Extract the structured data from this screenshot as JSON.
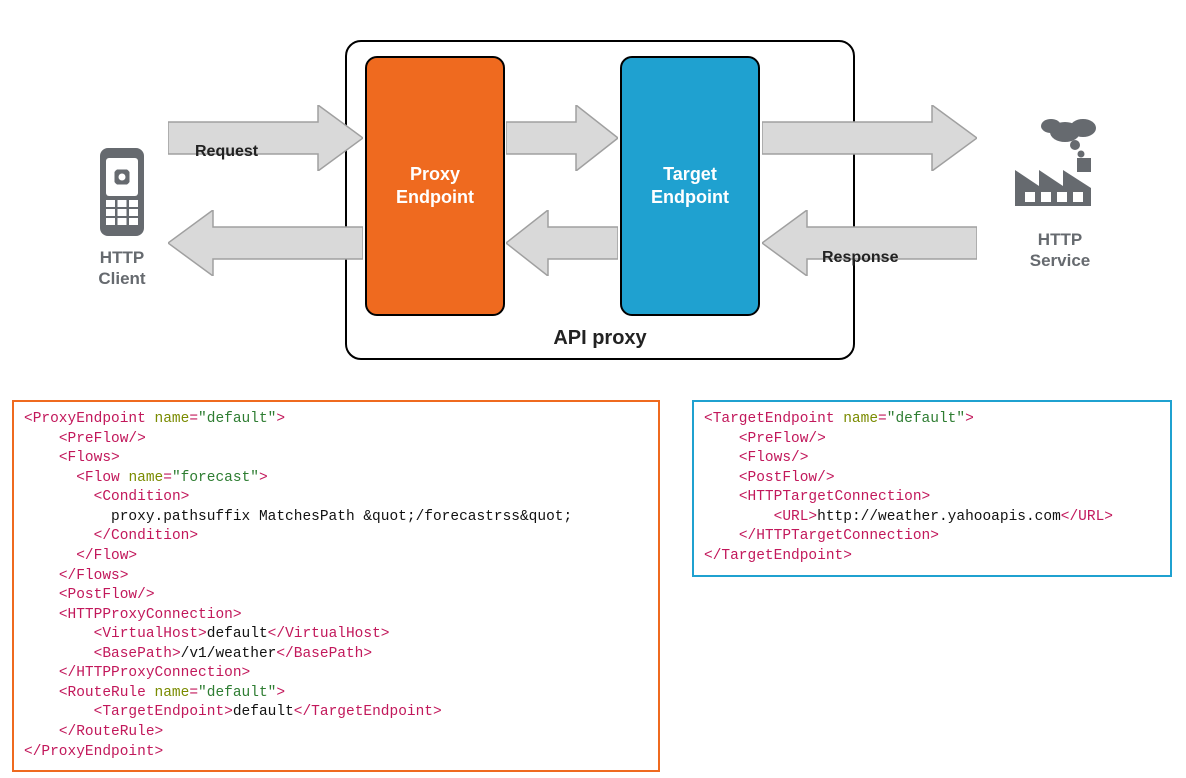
{
  "diagram": {
    "client_label": "HTTP\nClient",
    "service_label": "HTTP\nService",
    "request_label": "Request",
    "response_label": "Response",
    "proxy_container_title": "API proxy",
    "proxy_endpoint_label": "Proxy\nEndpoint",
    "target_endpoint_label": "Target\nEndpoint",
    "colors": {
      "proxy_endpoint": "#ef6a1f",
      "target_endpoint": "#1fa1d0",
      "arrow_fill": "#d9d9d9",
      "arrow_stroke": "#a0a0a0",
      "icon": "#666a6f"
    }
  },
  "code_proxy_endpoint": {
    "tokens": [
      [
        "tag",
        "<ProxyEndpoint "
      ],
      [
        "attr",
        "name"
      ],
      [
        "tag",
        "="
      ],
      [
        "val",
        "\"default\""
      ],
      [
        "tag",
        ">"
      ],
      [
        "nl",
        ""
      ],
      [
        "ind",
        "    "
      ],
      [
        "tag",
        "<PreFlow/>"
      ],
      [
        "nl",
        ""
      ],
      [
        "ind",
        "    "
      ],
      [
        "tag",
        "<Flows>"
      ],
      [
        "nl",
        ""
      ],
      [
        "ind",
        "      "
      ],
      [
        "tag",
        "<Flow "
      ],
      [
        "attr",
        "name"
      ],
      [
        "tag",
        "="
      ],
      [
        "val",
        "\"forecast\""
      ],
      [
        "tag",
        ">"
      ],
      [
        "nl",
        ""
      ],
      [
        "ind",
        "        "
      ],
      [
        "tag",
        "<Condition>"
      ],
      [
        "nl",
        ""
      ],
      [
        "ind",
        "          "
      ],
      [
        "txt",
        "proxy.pathsuffix MatchesPath &quot;/forecastrss&quot;"
      ],
      [
        "nl",
        ""
      ],
      [
        "ind",
        "        "
      ],
      [
        "tag",
        "</Condition>"
      ],
      [
        "nl",
        ""
      ],
      [
        "ind",
        "      "
      ],
      [
        "tag",
        "</Flow>"
      ],
      [
        "nl",
        ""
      ],
      [
        "ind",
        "    "
      ],
      [
        "tag",
        "</Flows>"
      ],
      [
        "nl",
        ""
      ],
      [
        "ind",
        "    "
      ],
      [
        "tag",
        "<PostFlow/>"
      ],
      [
        "nl",
        ""
      ],
      [
        "ind",
        "    "
      ],
      [
        "tag",
        "<HTTPProxyConnection>"
      ],
      [
        "nl",
        ""
      ],
      [
        "ind",
        "        "
      ],
      [
        "tag",
        "<VirtualHost>"
      ],
      [
        "txt",
        "default"
      ],
      [
        "tag",
        "</VirtualHost>"
      ],
      [
        "nl",
        ""
      ],
      [
        "ind",
        "        "
      ],
      [
        "tag",
        "<BasePath>"
      ],
      [
        "txt",
        "/v1/weather"
      ],
      [
        "tag",
        "</BasePath>"
      ],
      [
        "nl",
        ""
      ],
      [
        "ind",
        "    "
      ],
      [
        "tag",
        "</HTTPProxyConnection>"
      ],
      [
        "nl",
        ""
      ],
      [
        "ind",
        "    "
      ],
      [
        "tag",
        "<RouteRule "
      ],
      [
        "attr",
        "name"
      ],
      [
        "tag",
        "="
      ],
      [
        "val",
        "\"default\""
      ],
      [
        "tag",
        ">"
      ],
      [
        "nl",
        ""
      ],
      [
        "ind",
        "        "
      ],
      [
        "tag",
        "<TargetEndpoint>"
      ],
      [
        "txt",
        "default"
      ],
      [
        "tag",
        "</TargetEndpoint>"
      ],
      [
        "nl",
        ""
      ],
      [
        "ind",
        "    "
      ],
      [
        "tag",
        "</RouteRule>"
      ],
      [
        "nl",
        ""
      ],
      [
        "tag",
        "</ProxyEndpoint>"
      ]
    ]
  },
  "code_target_endpoint": {
    "tokens": [
      [
        "tag",
        "<TargetEndpoint "
      ],
      [
        "attr",
        "name"
      ],
      [
        "tag",
        "="
      ],
      [
        "val",
        "\"default\""
      ],
      [
        "tag",
        ">"
      ],
      [
        "nl",
        ""
      ],
      [
        "ind",
        "    "
      ],
      [
        "tag",
        "<PreFlow/>"
      ],
      [
        "nl",
        ""
      ],
      [
        "ind",
        "    "
      ],
      [
        "tag",
        "<Flows/>"
      ],
      [
        "nl",
        ""
      ],
      [
        "ind",
        "    "
      ],
      [
        "tag",
        "<PostFlow/>"
      ],
      [
        "nl",
        ""
      ],
      [
        "ind",
        "    "
      ],
      [
        "tag",
        "<HTTPTargetConnection>"
      ],
      [
        "nl",
        ""
      ],
      [
        "ind",
        "        "
      ],
      [
        "tag",
        "<URL>"
      ],
      [
        "txt",
        "http://weather.yahooapis.com"
      ],
      [
        "tag",
        "</URL>"
      ],
      [
        "nl",
        ""
      ],
      [
        "ind",
        "    "
      ],
      [
        "tag",
        "</HTTPTargetConnection>"
      ],
      [
        "nl",
        ""
      ],
      [
        "tag",
        "</TargetEndpoint>"
      ]
    ]
  }
}
